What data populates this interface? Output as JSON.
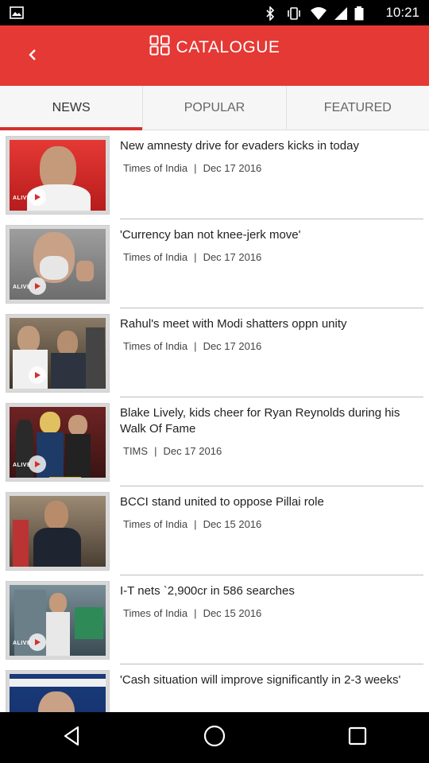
{
  "status_bar": {
    "time": "10:21",
    "icons": [
      "photo-icon",
      "bluetooth-icon",
      "vibrate-icon",
      "wifi-icon",
      "signal-icon",
      "battery-icon"
    ]
  },
  "header": {
    "title": "CATALOGUE",
    "title_icon": "grid-icon",
    "back_icon": "chevron-left-icon",
    "color": "#e53935"
  },
  "tabs": [
    {
      "label": "NEWS",
      "active": true
    },
    {
      "label": "POPULAR",
      "active": false
    },
    {
      "label": "FEATURED",
      "active": false
    }
  ],
  "articles": [
    {
      "title": "New amnesty drive for evaders kicks in today",
      "source": "Times of India",
      "separator": "|",
      "date": "Dec 17 2016",
      "thumb_tag": "ALIVE",
      "thumb_color": "#c62828"
    },
    {
      "title": "'Currency ban not knee-jerk move'",
      "source": "Times of India",
      "separator": "|",
      "date": "Dec 17 2016",
      "thumb_tag": "ALIVE",
      "thumb_color": "#8d8d8d"
    },
    {
      "title": "Rahul's meet with Modi shatters oppn unity",
      "source": "Times of India",
      "separator": "|",
      "date": "Dec 17 2016",
      "thumb_tag": "",
      "thumb_color": "#5d4b3a"
    },
    {
      "title": "Blake Lively, kids cheer for Ryan Reynolds during his Walk Of Fame",
      "source": "TIMS",
      "separator": "|",
      "date": "Dec 17 2016",
      "thumb_tag": "ALIVE",
      "thumb_color": "#7a2b2b"
    },
    {
      "title": "BCCI stand united to oppose Pillai role",
      "source": "Times of India",
      "separator": "|",
      "date": "Dec 15 2016",
      "thumb_tag": "",
      "thumb_color": "#6b5b4a"
    },
    {
      "title": "I-T nets `2,900cr in 586 searches",
      "source": "Times of India",
      "separator": "|",
      "date": "Dec 15 2016",
      "thumb_tag": "ALIVE",
      "thumb_color": "#4f6b78"
    },
    {
      "title": "'Cash situation will improve significantly in 2-3 weeks'",
      "source": "",
      "separator": "",
      "date": "",
      "thumb_tag": "",
      "thumb_color": "#1a3a7a"
    }
  ],
  "nav_bar": {
    "buttons": [
      "back-nav-icon",
      "home-nav-icon",
      "recents-nav-icon"
    ]
  }
}
